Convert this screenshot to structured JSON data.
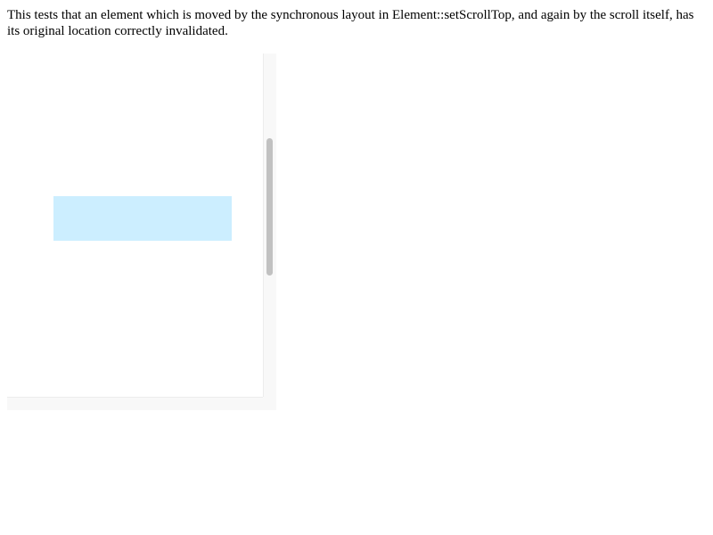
{
  "description": {
    "text": "This tests that an element which is moved by the synchronous layout in Element::setScrollTop, and again by the scroll itself, has its original location correctly invalidated."
  },
  "scroller": {
    "moved_box_color": "#cceeff",
    "vertical_scroll_position": 0.4,
    "thumb_fraction": 0.4
  },
  "colors": {
    "background": "#ffffff",
    "scrollbar_track": "#f8f8f8",
    "scrollbar_thumb": "#c1c1c1"
  }
}
